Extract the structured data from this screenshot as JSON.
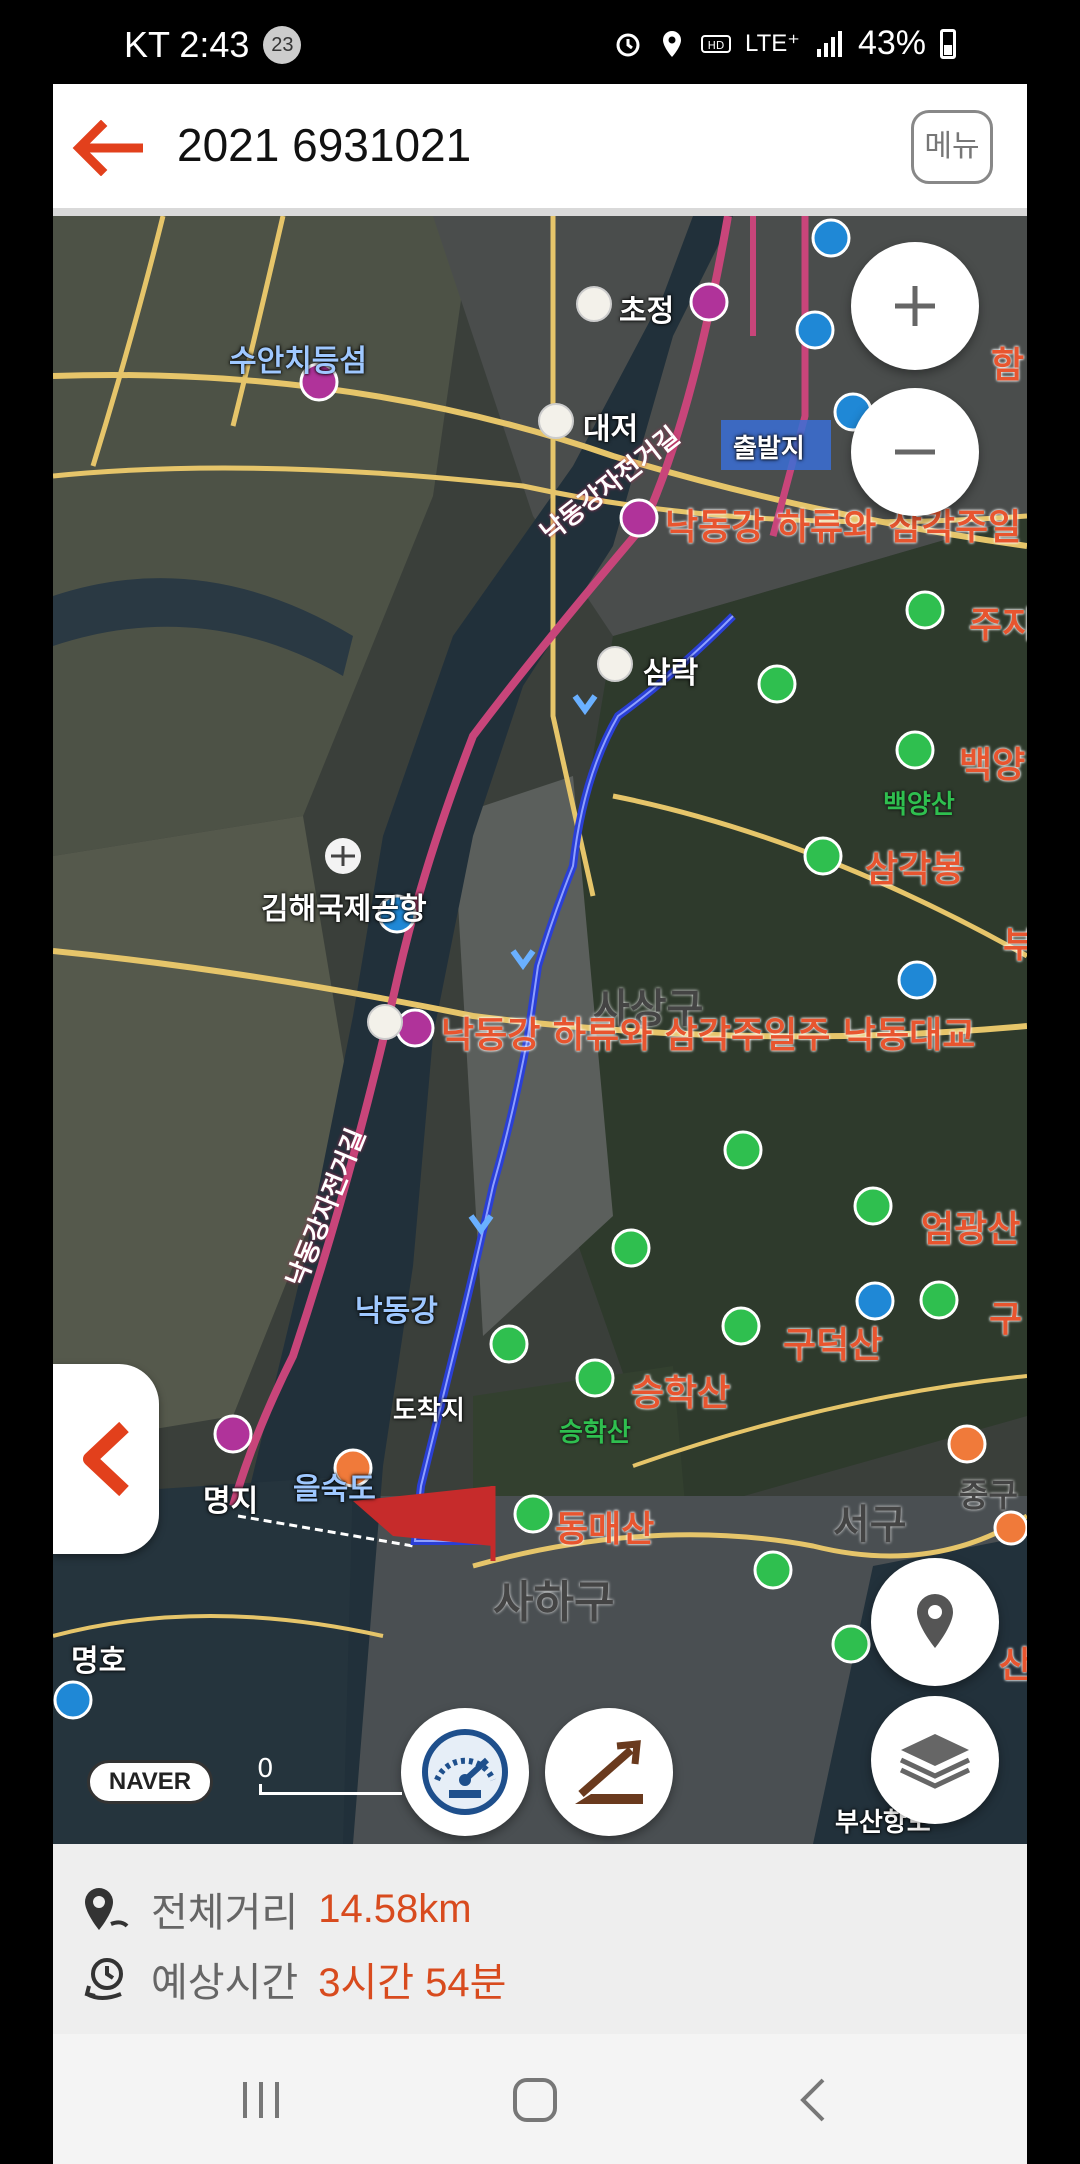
{
  "status_bar": {
    "carrier_time": "KT 2:43",
    "notification_count": "23",
    "network": "LTE⁺",
    "battery": "43%"
  },
  "header": {
    "title": "2021 6931021",
    "menu_label": "메뉴"
  },
  "map": {
    "labels": {
      "jochong": "초정",
      "suanchi": "수안치등섬",
      "daeji": "대저",
      "start": "출발지",
      "nakdong_delta_1": "낙동강 하류와 삼각주일",
      "samnak": "삼락",
      "juji": "주지",
      "baekyang_big": "백양",
      "baekyangsan": "백양산",
      "samgakbong": "삼각봉",
      "gimhae_airport": "김해국제공항",
      "sasang": "사상구",
      "nakdong_delta_2": "낙동강 하류와 삼각주일주 낙동대교",
      "eomgwangsan": "엄광산",
      "gudeoksan": "구덕산",
      "gu_right": "구",
      "nakdonggang": "낙동강",
      "arrival": "도착지",
      "seunghaksan_big": "승학산",
      "seunghaksan_small": "승학산",
      "myeongji": "명지",
      "eulsukdo": "을숙도",
      "seogu": "서구",
      "junggu": "중구",
      "dongmaesan": "동매산",
      "saha": "사하구",
      "myeongho": "명호",
      "busan_port": "부산항도",
      "bike_road_1": "낙동강자전거길",
      "bike_road_2": "낙동강자전거길",
      "ham": "함",
      "right_edge_1": "부",
      "right_edge_2": "산"
    },
    "naver_logo": "NAVER",
    "scale_value": "0"
  },
  "route_info": {
    "distance_label": "전체거리",
    "distance_value": "14.58km",
    "time_label": "예상시간",
    "time_value": "3시간 54분"
  },
  "colors": {
    "accent": "#d84b1e",
    "route": "#2a3fd6",
    "bike_road": "#c8457a"
  }
}
